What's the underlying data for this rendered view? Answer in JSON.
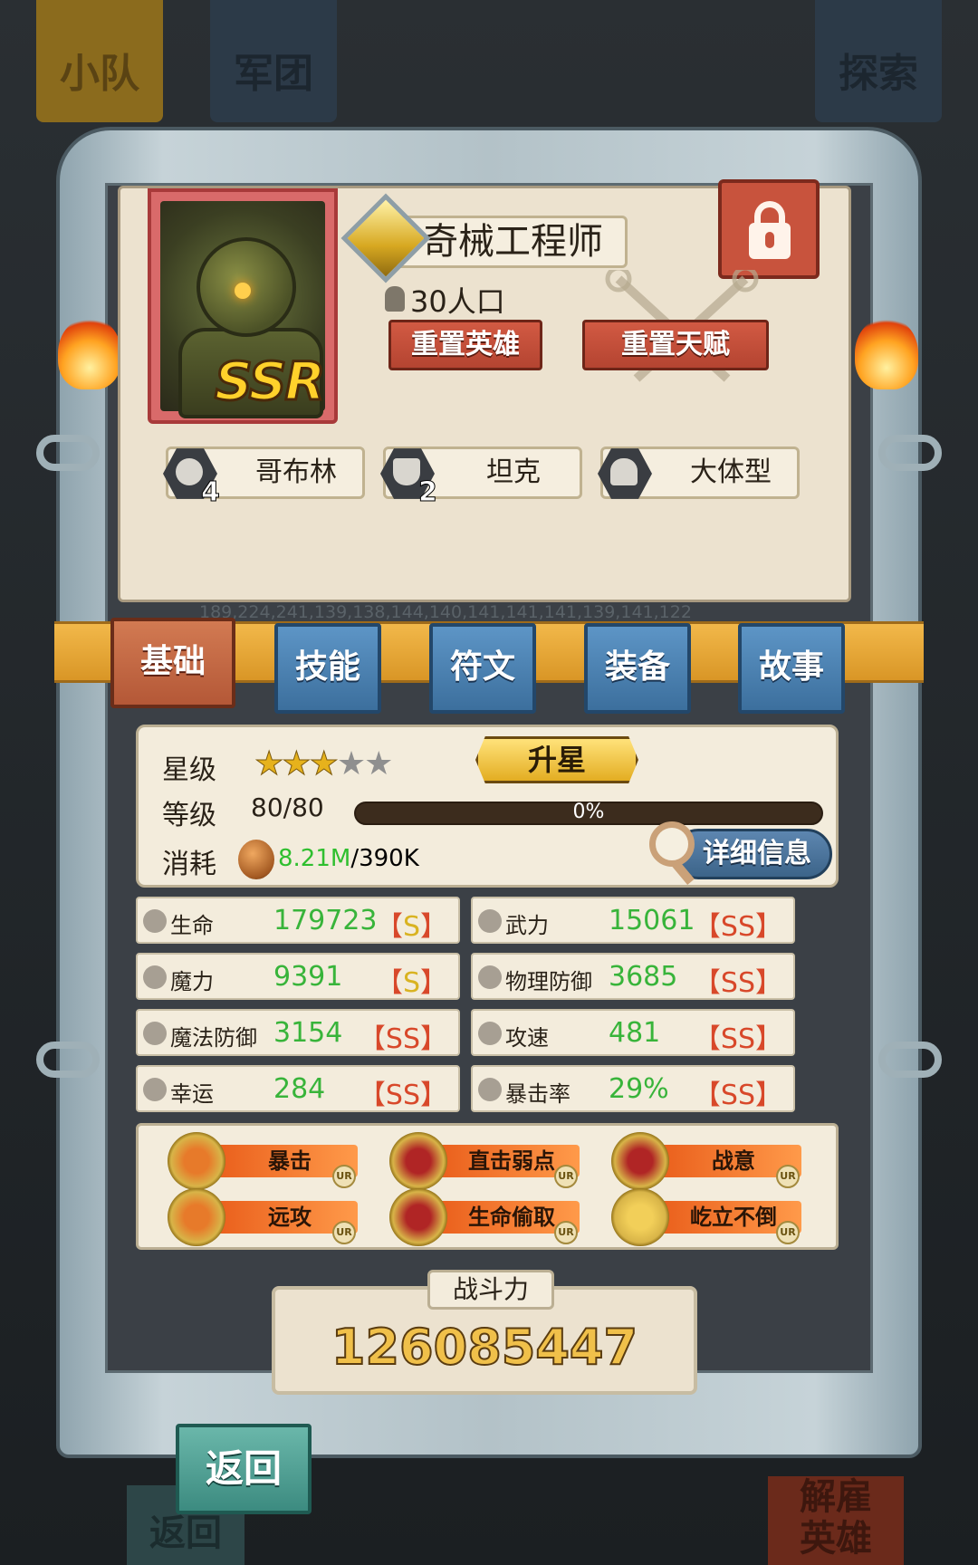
{
  "background_tabs": {
    "squad": "小队",
    "legion": "军团",
    "explore": "探索"
  },
  "background_bottom": {
    "back_label": "返回",
    "dismiss_label": "解雇\n英雄"
  },
  "hero": {
    "name": "奇械工程师",
    "rarity": "SSR",
    "population": "30人口",
    "reset_hero_label": "重置英雄",
    "reset_talent_label": "重置天赋",
    "lock_icon": "lock-icon",
    "tags": [
      {
        "count": "4",
        "label": "哥布林",
        "icon": "goblin-icon"
      },
      {
        "count": "2",
        "label": "坦克",
        "icon": "shield-icon"
      },
      {
        "count": "",
        "label": "大体型",
        "icon": "ghost-icon"
      }
    ]
  },
  "debug_text": "189,224,241,139,138,144,140,141,141,141,139,141,122",
  "tabs": [
    {
      "label": "基础",
      "active": true
    },
    {
      "label": "技能",
      "active": false
    },
    {
      "label": "符文",
      "active": false
    },
    {
      "label": "装备",
      "active": false
    },
    {
      "label": "故事",
      "active": false
    }
  ],
  "basic": {
    "star_label": "星级",
    "stars_filled": 3,
    "stars_total": 5,
    "upgrade_star_label": "升星",
    "level_label": "等级",
    "level": "80/80",
    "exp_percent": "0%",
    "exp_fraction": 0,
    "cost_label": "消耗",
    "cost_have": "8.21M",
    "cost_need": "/390K",
    "detail_label": "详细信息"
  },
  "attributes": [
    {
      "name": "生命",
      "value": "179723",
      "grade": "S",
      "icon": "heart-icon"
    },
    {
      "name": "武力",
      "value": "15061",
      "grade": "SS",
      "icon": "sword-icon"
    },
    {
      "name": "魔力",
      "value": "9391",
      "grade": "S",
      "icon": "sparkle-icon"
    },
    {
      "name": "物理防御",
      "value": "3685",
      "grade": "SS",
      "icon": "shield-icon"
    },
    {
      "name": "魔法防御",
      "value": "3154",
      "grade": "SS",
      "icon": "magic-shield-icon"
    },
    {
      "name": "攻速",
      "value": "481",
      "grade": "SS",
      "icon": "fist-icon"
    },
    {
      "name": "幸运",
      "value": "284",
      "grade": "SS",
      "icon": "clover-icon"
    },
    {
      "name": "暴击率",
      "value": "29%",
      "grade": "SS",
      "icon": "burst-icon"
    }
  ],
  "skills": [
    {
      "name": "暴击",
      "badge": "UR"
    },
    {
      "name": "直击弱点",
      "badge": "UR"
    },
    {
      "name": "战意",
      "badge": "UR"
    },
    {
      "name": "远攻",
      "badge": "UR"
    },
    {
      "name": "生命偷取",
      "badge": "UR"
    },
    {
      "name": "屹立不倒",
      "badge": "UR"
    }
  ],
  "power": {
    "label": "战斗力",
    "value": "126085447"
  },
  "back_label": "返回",
  "colors": {
    "value_green": "#38b43a",
    "grade_gold": "#d9b321",
    "grade_red": "#d8482a",
    "tab_blue": "#4a82b4",
    "tab_active": "#c06a45"
  }
}
